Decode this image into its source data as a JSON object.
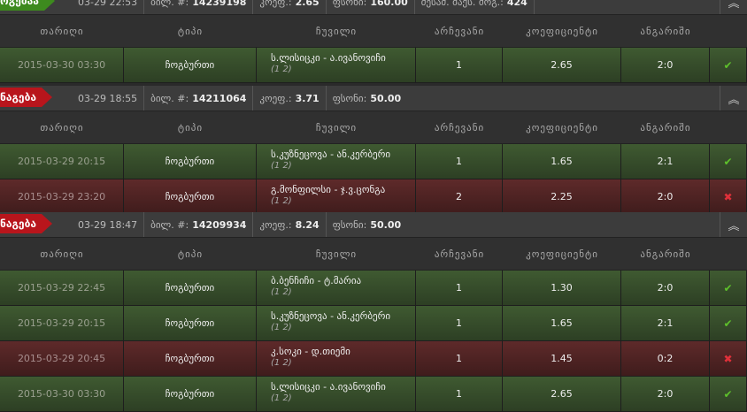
{
  "table_headers": {
    "date": "თარიღი",
    "type": "ტიპი",
    "event": "ჩუვილი",
    "choice": "არჩევანი",
    "odds": "კოეფიციენტი",
    "score": "ანგარიში"
  },
  "coupons": [
    {
      "badge": "ოგებაა",
      "badge_color": "#3d8a1e",
      "datetime": "03-29 22:53",
      "ticket_label": "ბილ. #:",
      "ticket": "14239198",
      "coef_label": "კოეფ.:",
      "coef": "2.65",
      "stake_label": "ფსონი:",
      "stake": "160.00",
      "win_label": "შესაძ. მაქს. მოგ.:",
      "win": "424",
      "collapse_icon": "double-chevron-up-icon",
      "rows": [
        {
          "date": "2015-03-30 03:30",
          "type": "ჩოგბურთი",
          "event": "ს.ლისიცკი - ა.ივანოვიჩი",
          "sub": "(1 2)",
          "choice": "1",
          "odds": "2.65",
          "score": "2:0",
          "status": "✔",
          "result": "win"
        }
      ]
    },
    {
      "badge": "ნაგება",
      "badge_color": "#b8151c",
      "datetime": "03-29 18:55",
      "ticket_label": "ბილ. #:",
      "ticket": "14211064",
      "coef_label": "კოეფ.:",
      "coef": "3.71",
      "stake_label": "ფსონი:",
      "stake": "50.00",
      "collapse_icon": "double-chevron-up-icon",
      "rows": [
        {
          "date": "2015-03-29 20:15",
          "type": "ჩოგბურთი",
          "event": "ს.კუზნეცოვა - ან.კერბერი",
          "sub": "(1 2)",
          "choice": "1",
          "odds": "1.65",
          "score": "2:1",
          "status": "✔",
          "result": "win"
        },
        {
          "date": "2015-03-29 23:20",
          "type": "ჩოგბურთი",
          "event": "გ.მონფილსი - ჯ.ვ.ცონგა",
          "sub": "(1 2)",
          "choice": "2",
          "odds": "2.25",
          "score": "2:0",
          "status": "✖",
          "result": "lose"
        }
      ]
    },
    {
      "badge": "ნაგება",
      "badge_color": "#b8151c",
      "datetime": "03-29 18:47",
      "ticket_label": "ბილ. #:",
      "ticket": "14209934",
      "coef_label": "კოეფ.:",
      "coef": "8.24",
      "stake_label": "ფსონი:",
      "stake": "50.00",
      "collapse_icon": "double-chevron-up-icon",
      "rows": [
        {
          "date": "2015-03-29 22:45",
          "type": "ჩოგბურთი",
          "event": "ბ.ბენჩიჩი - ტ.მარია",
          "sub": "(1 2)",
          "choice": "1",
          "odds": "1.30",
          "score": "2:0",
          "status": "✔",
          "result": "win"
        },
        {
          "date": "2015-03-29 20:15",
          "type": "ჩოგბურთი",
          "event": "ს.კუზნეცოვა - ან.კერბერი",
          "sub": "(1 2)",
          "choice": "1",
          "odds": "1.65",
          "score": "2:1",
          "status": "✔",
          "result": "win"
        },
        {
          "date": "2015-03-29 20:45",
          "type": "ჩოგბურთი",
          "event": "კ.სოკი - დ.თიემი",
          "sub": "(1 2)",
          "choice": "1",
          "odds": "1.45",
          "score": "0:2",
          "status": "✖",
          "result": "lose"
        },
        {
          "date": "2015-03-30 03:30",
          "type": "ჩოგბურთი",
          "event": "ს.ლისიცკი - ა.ივანოვიჩი",
          "sub": "(1 2)",
          "choice": "1",
          "odds": "2.65",
          "score": "2:0",
          "status": "✔",
          "result": "win"
        }
      ]
    }
  ]
}
